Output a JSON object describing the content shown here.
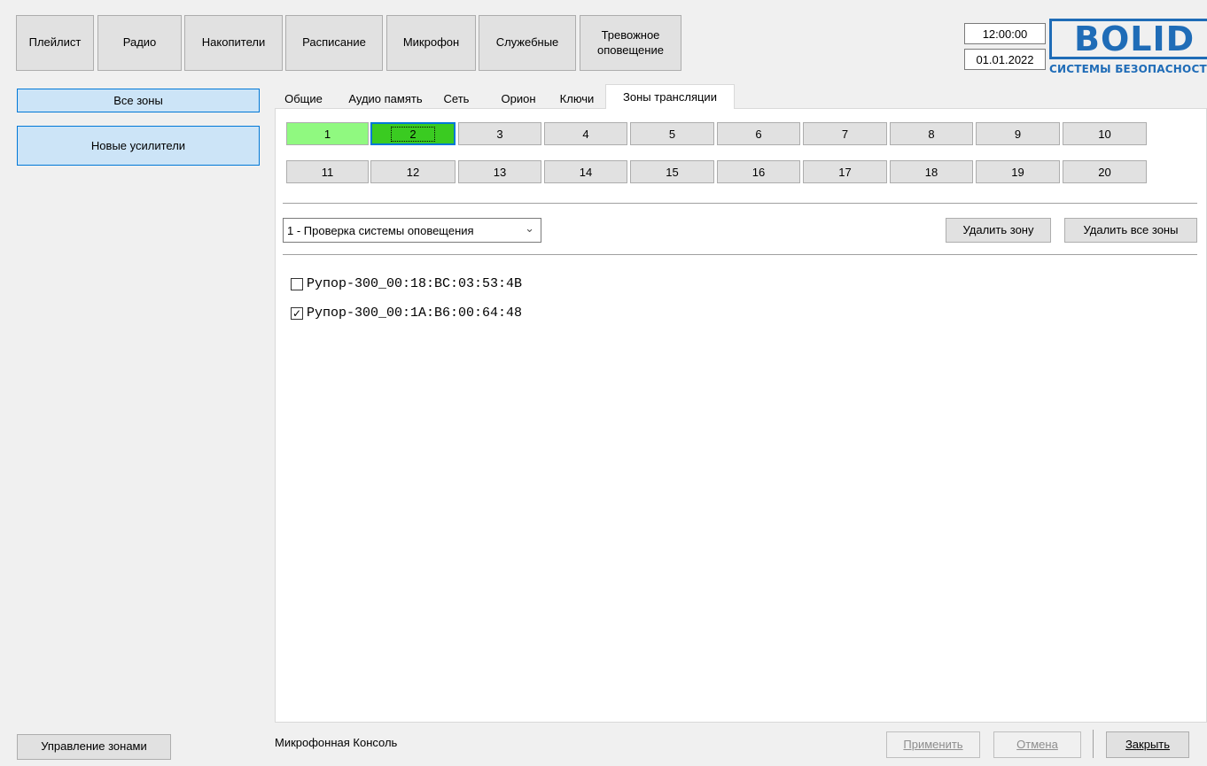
{
  "top_menu": [
    {
      "label": "Плейлист"
    },
    {
      "label": "Радио"
    },
    {
      "label": "Накопители"
    },
    {
      "label": "Расписание"
    },
    {
      "label": "Микрофон"
    },
    {
      "label": "Служебные"
    },
    {
      "label": "Тревожное\nоповещение"
    }
  ],
  "clock": {
    "time": "12:00:00",
    "date": "01.01.2022"
  },
  "logo": {
    "word": "BOLID",
    "subtitle": "СИСТЕМЫ БЕЗОПАСНОСТИ"
  },
  "sidebar": {
    "all_zones": "Все зоны",
    "new_amplifiers": "Новые усилители",
    "manage_zones": "Управление зонами"
  },
  "tabs": [
    {
      "label": "Общие"
    },
    {
      "label": "Аудио память"
    },
    {
      "label": "Сеть"
    },
    {
      "label": "Орион"
    },
    {
      "label": "Ключи"
    },
    {
      "label": "Зоны трансляции",
      "active": true
    }
  ],
  "zones": {
    "row1": [
      "1",
      "2",
      "3",
      "4",
      "5",
      "6",
      "7",
      "8",
      "9",
      "10"
    ],
    "row2": [
      "11",
      "12",
      "13",
      "14",
      "15",
      "16",
      "17",
      "18",
      "19",
      "20"
    ],
    "used": [
      "1"
    ],
    "selected": "2",
    "colors": {
      "used": "#90f980",
      "selected": "#3acb21",
      "accent": "#0078d7"
    }
  },
  "zone_select": {
    "value": "1 - Проверка системы оповещения"
  },
  "actions": {
    "delete_zone": "Удалить зону",
    "delete_all_zones": "Удалить все зоны"
  },
  "devices": [
    {
      "label": "Рупор-300_00:18:BC:03:53:4B",
      "checked": false
    },
    {
      "label": "Рупор-300_00:1A:B6:00:64:48",
      "checked": true
    }
  ],
  "footer": {
    "device_name": "Микрофонная Консоль",
    "apply": "Применить",
    "cancel": "Отмена",
    "close": "Закрыть"
  }
}
